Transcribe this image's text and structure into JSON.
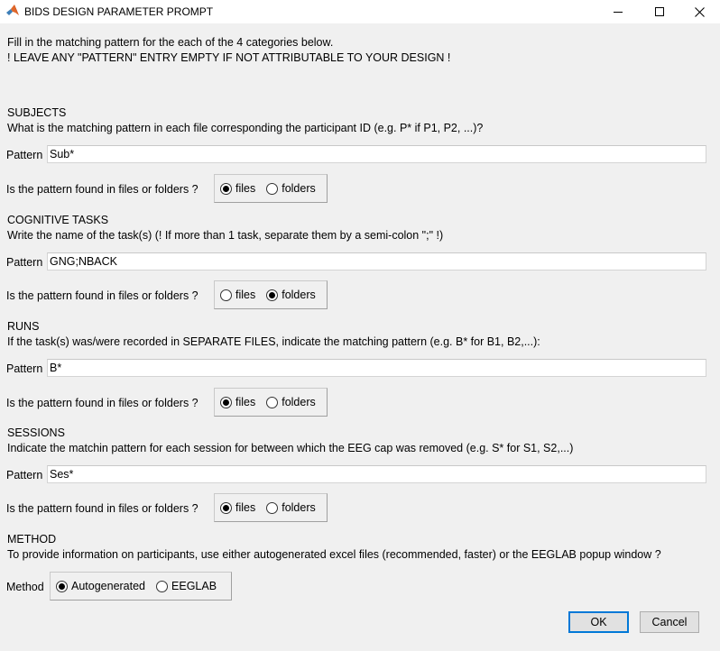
{
  "window": {
    "title": "BIDS DESIGN PARAMETER PROMPT",
    "icon": "matlab-icon",
    "controls": {
      "minimize": "—",
      "maximize": "☐",
      "close": "✕"
    }
  },
  "intro": {
    "line1": "Fill in the matching pattern for the each of the 4 categories below.",
    "line2": "! LEAVE ANY \"PATTERN\" ENTRY EMPTY IF NOT ATTRIBUTABLE TO YOUR DESIGN !"
  },
  "pattern_label": "Pattern",
  "location_question": "Is the pattern found in files or folders ?",
  "option_files": "files",
  "option_folders": "folders",
  "subjects": {
    "heading": "SUBJECTS",
    "description": "What is the matching pattern in each file corresponding the participant ID (e.g. P* if P1, P2, ...)?",
    "value": "Sub*",
    "selected": "files"
  },
  "tasks": {
    "heading": "COGNITIVE TASKS",
    "description": "Write the name of the task(s) (! If more than 1 task, separate them by a semi-colon \";\" !)",
    "value": "GNG;NBACK",
    "selected": "folders"
  },
  "runs": {
    "heading": "RUNS",
    "description": "If the task(s) was/were recorded in SEPARATE FILES, indicate the matching pattern (e.g. B* for B1, B2,...):",
    "value": "B*",
    "selected": "files"
  },
  "sessions": {
    "heading": "SESSIONS",
    "description": "Indicate the matchin pattern for each session for between which the EEG cap was removed (e.g. S* for S1, S2,...)",
    "value": "Ses*",
    "selected": "files"
  },
  "method": {
    "heading": "METHOD",
    "description": "To provide information on participants, use either autogenerated excel files (recommended, faster) or the EEGLAB popup window ?",
    "label": "Method",
    "options": [
      "Autogenerated",
      "EEGLAB"
    ],
    "selected": "Autogenerated"
  },
  "buttons": {
    "ok": "OK",
    "cancel": "Cancel"
  }
}
